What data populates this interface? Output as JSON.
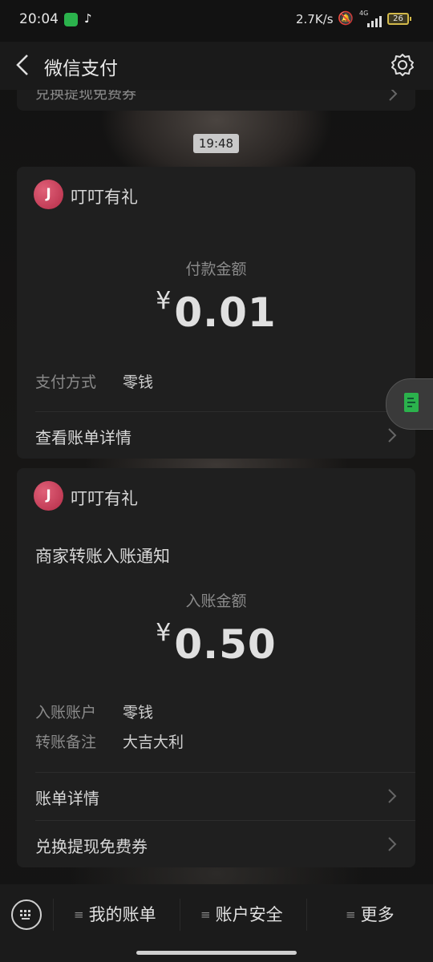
{
  "status_bar": {
    "time": "20:04",
    "net_speed": "2.7K/s",
    "network": "4G",
    "battery": "26"
  },
  "nav": {
    "title": "微信支付"
  },
  "top_card": {
    "text": "兑换提现免费券"
  },
  "timestamp": "19:48",
  "payment_card": {
    "merchant": "叮叮有礼",
    "avatar_letter": "J",
    "amount_label": "付款金额",
    "currency": "¥",
    "amount": "0.01",
    "method_label": "支付方式",
    "method_value": "零钱",
    "details_link": "查看账单详情"
  },
  "transfer_card": {
    "merchant": "叮叮有礼",
    "avatar_letter": "J",
    "notice_title": "商家转账入账通知",
    "amount_label": "入账金额",
    "currency": "¥",
    "amount": "0.50",
    "account_label": "入账账户",
    "account_value": "零钱",
    "remark_label": "转账备注",
    "remark_value": "大吉大利",
    "details_link": "账单详情",
    "voucher_link": "兑换提现免费券"
  },
  "bottom_menu": {
    "items": [
      "我的账单",
      "账户安全",
      "更多"
    ]
  },
  "colors": {
    "accent_green": "#2bb24c",
    "avatar_red": "#c43a55",
    "card_bg": "#1f1f1f"
  }
}
